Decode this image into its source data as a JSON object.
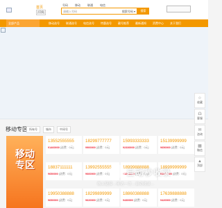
{
  "header": {
    "city": "首页",
    "city_switch": "[切换]",
    "search_tabs": [
      "号码",
      "移动",
      "联通",
      "电信"
    ],
    "search_placeholder": "请输入号码",
    "search_select": "搜索号码 ▾",
    "search_button": "搜索"
  },
  "nav": {
    "category": "全部产品",
    "items": [
      "移动选号",
      "联通选号",
      "电信选号",
      "特惠选号",
      "靓号推荐",
      "最新通知",
      "资费中心",
      "关于我们"
    ]
  },
  "section": {
    "title": "移动专区",
    "filters": [
      "所有号",
      "城市",
      "中间号"
    ],
    "promo_text": "移动专区"
  },
  "cards": [
    {
      "number": "13552555555",
      "price": "¥1460000",
      "note": "[送费：0元]"
    },
    {
      "number": "18299777777",
      "price": "¥900000",
      "note": "[送费：0元]"
    },
    {
      "number": "15993333333",
      "price": "¥2330000",
      "note": "[送费：0元]"
    },
    {
      "number": "15139999999",
      "price": "¥650000",
      "note": "[送费：0元]"
    },
    {
      "number": "18837111111",
      "price": "¥650000",
      "note": "[送费：0元]"
    },
    {
      "number": "13992555555",
      "price": "¥660000",
      "note": "[送费：0元]"
    },
    {
      "number": "18999888888",
      "price": "¥1268000",
      "note": "[送费：0元]"
    },
    {
      "number": "18999999999",
      "price": "¥1368000",
      "note": "[送费：0元]"
    },
    {
      "number": "19950388888",
      "price": "¥650000",
      "note": "[送费：0元]"
    },
    {
      "number": "18299899999",
      "price": "¥620000",
      "note": "[送费：0元]"
    },
    {
      "number": "18860388888",
      "price": "¥430000",
      "note": "[送费：0元]"
    },
    {
      "number": "17639888888",
      "price": "¥420000",
      "note": "[送费：0元]"
    }
  ],
  "sidebar": [
    {
      "icon": "star-icon",
      "label": "收藏"
    },
    {
      "icon": "headset-icon",
      "label": "客服"
    },
    {
      "icon": "chat-icon",
      "label": "咨询"
    },
    {
      "icon": "qr-icon",
      "label": "微信"
    },
    {
      "icon": "arrow-up-icon",
      "label": "顶部"
    }
  ],
  "watermark": {
    "title": "自动秒收录",
    "subtitle": "做上链接→来访一次→自动收录→"
  }
}
